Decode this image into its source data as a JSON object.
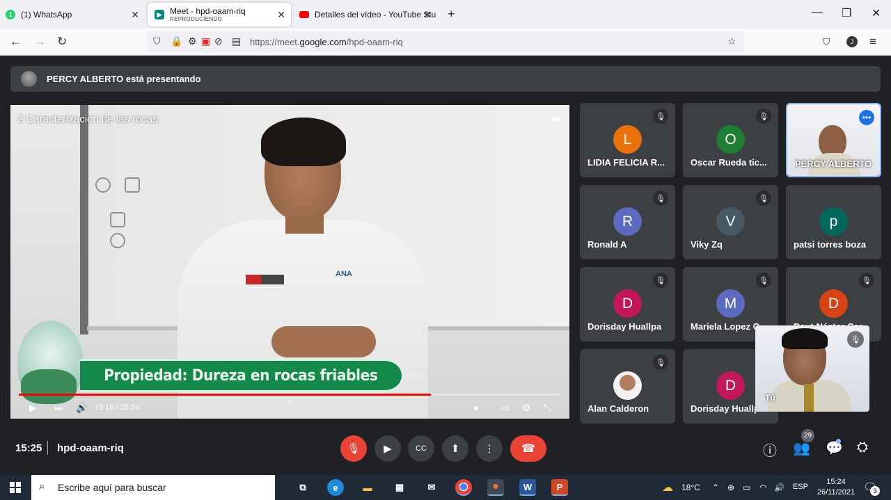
{
  "browser": {
    "tabs": [
      {
        "title": "(1) WhatsApp",
        "close": "✕",
        "icon": "whatsapp-icon"
      },
      {
        "title": "Meet - hpd-oaam-riq",
        "subtitle": "REPRODUCIENDO",
        "close": "✕",
        "icon": "meet-icon"
      },
      {
        "title": "Detalles del vídeo - YouTube Stu",
        "close": "✕",
        "icon": "youtube-icon"
      }
    ],
    "new_tab": "+",
    "url_prefix": "https://meet.",
    "url_domain": "google.com",
    "url_path": "/hpd-oaam-riq",
    "profile_initial": "J"
  },
  "meet": {
    "presenter_text": "PERCY ALBERTO está presentando",
    "video": {
      "title": "2 Caracterización de las rocas",
      "banner": "Propiedad: Dureza en rocas friables",
      "time": "19:16 / 25:24",
      "progress": 0.76,
      "shirt_logo": "ANA"
    },
    "participants": [
      {
        "name": "LIDIA FELICIA R...",
        "initial": "L",
        "color": "#e8710a",
        "muted": true
      },
      {
        "name": "Oscar Rueda tic...",
        "initial": "O",
        "color": "#1e7e34",
        "muted": true
      },
      {
        "name": "PERCY ALBERTO",
        "initial": "",
        "color": "",
        "muted": false,
        "video": true
      },
      {
        "name": "Ronald A",
        "initial": "R",
        "color": "#5c6bc0",
        "muted": true
      },
      {
        "name": "Viky Zq",
        "initial": "V",
        "color": "#455a64",
        "muted": true
      },
      {
        "name": "patsi torres boza",
        "initial": "p",
        "color": "#00695c",
        "muted": false
      },
      {
        "name": "Dorisday Huallpa",
        "initial": "D",
        "color": "#c2185b",
        "muted": true
      },
      {
        "name": "Mariela Lopez C...",
        "initial": "M",
        "color": "#5c6bc0",
        "muted": true
      },
      {
        "name": "Daut Néstor Car...",
        "initial": "D",
        "color": "#d84315",
        "muted": true
      },
      {
        "name": "Alan Calderon",
        "initial": "",
        "color": "",
        "muted": true,
        "photo": true
      },
      {
        "name": "Dorisday Huallpa",
        "initial": "D",
        "color": "#c2185b",
        "muted": false
      }
    ],
    "self_label": "Tú",
    "clock": "15:25",
    "meeting_code": "hpd-oaam-riq",
    "participant_count": "29",
    "colors": {
      "bg": "#202124",
      "tile": "#3c4043",
      "danger": "#ea4335",
      "accent": "#8ab4f8"
    }
  },
  "taskbar": {
    "search_placeholder": "Escribe aquí para buscar",
    "weather": "18°C",
    "lang": "ESP",
    "time": "15:24",
    "date": "26/11/2021",
    "notifications": "3"
  }
}
